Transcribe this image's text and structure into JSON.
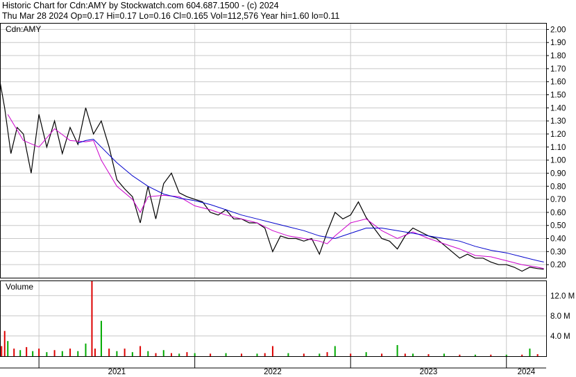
{
  "header": {
    "line1": "Historic Chart for Cdn:AMY by Stockwatch.com 604.687.1500 - (c) 2024",
    "line2": "Thu Mar 28 2024  Op=0.17  Hi=0.17  Lo=0.16  Cl=0.165  Vol=112,576  Year hi=1.60  lo=0.11"
  },
  "chart_data": [
    {
      "type": "line",
      "panel": "price",
      "label": "Cdn:AMY",
      "y_ticks": [
        "2.00",
        "1.90",
        "1.80",
        "1.70",
        "1.60",
        "1.50",
        "1.40",
        "1.30",
        "1.20",
        "1.10",
        "1.00",
        "0.90",
        "0.80",
        "0.70",
        "0.60",
        "0.50",
        "0.40",
        "0.30",
        "0.20"
      ],
      "ylim": [
        0.1,
        2.05
      ],
      "x_labels": [
        "2021",
        "2022",
        "2023",
        "2024"
      ],
      "series": [
        {
          "role": "close",
          "color": "#000000",
          "x": [
            2020.75,
            2020.78,
            2020.82,
            2020.86,
            2020.9,
            2020.95,
            2021.0,
            2021.05,
            2021.1,
            2021.15,
            2021.2,
            2021.25,
            2021.3,
            2021.35,
            2021.4,
            2021.45,
            2021.5,
            2021.55,
            2021.6,
            2021.65,
            2021.7,
            2021.75,
            2021.8,
            2021.85,
            2021.9,
            2021.95,
            2022.0,
            2022.05,
            2022.1,
            2022.15,
            2022.2,
            2022.25,
            2022.3,
            2022.35,
            2022.4,
            2022.45,
            2022.5,
            2022.55,
            2022.6,
            2022.65,
            2022.7,
            2022.75,
            2022.8,
            2022.85,
            2022.9,
            2022.95,
            2023.0,
            2023.05,
            2023.1,
            2023.15,
            2023.2,
            2023.25,
            2023.3,
            2023.35,
            2023.4,
            2023.45,
            2023.5,
            2023.55,
            2023.6,
            2023.65,
            2023.7,
            2023.75,
            2023.8,
            2023.85,
            2023.9,
            2023.95,
            2024.0,
            2024.05,
            2024.1,
            2024.15,
            2024.2,
            2024.24
          ],
          "y": [
            1.6,
            1.4,
            1.05,
            1.25,
            1.2,
            0.9,
            1.35,
            1.1,
            1.3,
            1.05,
            1.25,
            1.12,
            1.4,
            1.2,
            1.3,
            1.1,
            0.85,
            0.78,
            0.72,
            0.52,
            0.8,
            0.55,
            0.82,
            0.9,
            0.75,
            0.72,
            0.7,
            0.68,
            0.6,
            0.58,
            0.62,
            0.55,
            0.55,
            0.52,
            0.52,
            0.48,
            0.3,
            0.42,
            0.4,
            0.4,
            0.38,
            0.4,
            0.28,
            0.45,
            0.6,
            0.55,
            0.58,
            0.68,
            0.56,
            0.48,
            0.4,
            0.38,
            0.32,
            0.42,
            0.48,
            0.45,
            0.42,
            0.4,
            0.35,
            0.3,
            0.25,
            0.28,
            0.25,
            0.25,
            0.22,
            0.2,
            0.2,
            0.18,
            0.15,
            0.18,
            0.17,
            0.165
          ]
        },
        {
          "role": "moving-average-short",
          "color": "#cc00cc",
          "x": [
            2020.8,
            2020.9,
            2021.0,
            2021.1,
            2021.2,
            2021.3,
            2021.35,
            2021.4,
            2021.5,
            2021.6,
            2021.65,
            2021.7,
            2021.8,
            2021.9,
            2022.0,
            2022.1,
            2022.2,
            2022.3,
            2022.4,
            2022.5,
            2022.6,
            2022.7,
            2022.8,
            2022.85,
            2022.9,
            2023.0,
            2023.1,
            2023.2,
            2023.3,
            2023.4,
            2023.5,
            2023.6,
            2023.7,
            2023.8,
            2023.9,
            2024.0,
            2024.1,
            2024.2,
            2024.24
          ],
          "y": [
            1.35,
            1.15,
            1.1,
            1.24,
            1.15,
            1.14,
            1.15,
            1.0,
            0.8,
            0.7,
            0.6,
            0.72,
            0.73,
            0.72,
            0.65,
            0.62,
            0.58,
            0.55,
            0.52,
            0.46,
            0.42,
            0.4,
            0.38,
            0.36,
            0.42,
            0.52,
            0.55,
            0.46,
            0.4,
            0.45,
            0.4,
            0.36,
            0.32,
            0.27,
            0.26,
            0.23,
            0.2,
            0.18,
            0.17
          ]
        },
        {
          "role": "moving-average-long",
          "color": "#0000cc",
          "x": [
            2021.25,
            2021.3,
            2021.35,
            2021.4,
            2021.5,
            2021.6,
            2021.7,
            2021.8,
            2021.9,
            2022.0,
            2022.1,
            2022.2,
            2022.3,
            2022.4,
            2022.5,
            2022.6,
            2022.7,
            2022.8,
            2022.9,
            2023.0,
            2023.1,
            2023.2,
            2023.3,
            2023.4,
            2023.5,
            2023.6,
            2023.7,
            2023.8,
            2023.9,
            2024.0,
            2024.1,
            2024.2,
            2024.24
          ],
          "y": [
            1.13,
            1.15,
            1.16,
            1.1,
            0.98,
            0.88,
            0.8,
            0.74,
            0.71,
            0.69,
            0.66,
            0.62,
            0.58,
            0.55,
            0.52,
            0.49,
            0.46,
            0.42,
            0.4,
            0.44,
            0.48,
            0.48,
            0.46,
            0.44,
            0.42,
            0.4,
            0.38,
            0.34,
            0.31,
            0.29,
            0.26,
            0.23,
            0.22
          ]
        }
      ]
    },
    {
      "type": "bar",
      "panel": "volume",
      "label": "Volume",
      "y_ticks": [
        "12.0 M",
        "8.0 M",
        "4.0 M"
      ],
      "ylim": [
        0,
        15
      ],
      "unit": "M",
      "series": [
        {
          "name": "",
          "x": [
            2020.76,
            2020.78,
            2020.8,
            2020.84,
            2020.88,
            2020.92,
            2020.96,
            2021.0,
            2021.05,
            2021.1,
            2021.15,
            2021.2,
            2021.25,
            2021.3,
            2021.34,
            2021.36,
            2021.4,
            2021.45,
            2021.5,
            2021.55,
            2021.6,
            2021.65,
            2021.7,
            2021.75,
            2021.8,
            2021.85,
            2021.9,
            2021.95,
            2022.0,
            2022.1,
            2022.2,
            2022.3,
            2022.4,
            2022.45,
            2022.5,
            2022.6,
            2022.7,
            2022.8,
            2022.85,
            2022.9,
            2023.0,
            2023.1,
            2023.2,
            2023.3,
            2023.35,
            2023.4,
            2023.5,
            2023.6,
            2023.7,
            2023.8,
            2023.9,
            2024.0,
            2024.1,
            2024.15,
            2024.2
          ],
          "values": [
            2.0,
            5.0,
            3.0,
            1.5,
            1.2,
            1.8,
            1.0,
            1.5,
            0.8,
            1.2,
            1.0,
            1.5,
            1.0,
            2.5,
            15.0,
            1.5,
            7.0,
            1.5,
            1.0,
            1.5,
            0.8,
            2.0,
            1.0,
            0.6,
            1.2,
            0.6,
            0.5,
            0.8,
            0.6,
            0.5,
            0.6,
            0.5,
            0.5,
            0.6,
            2.0,
            0.6,
            0.5,
            0.5,
            0.8,
            2.0,
            0.5,
            0.8,
            0.5,
            2.2,
            0.5,
            0.5,
            0.4,
            0.5,
            0.3,
            0.3,
            0.3,
            0.3,
            0.3,
            1.5,
            0.4
          ],
          "colors": [
            "red",
            "red",
            "green",
            "red",
            "green",
            "red",
            "green",
            "red",
            "green",
            "red",
            "green",
            "red",
            "green",
            "green",
            "red",
            "red",
            "green",
            "red",
            "green",
            "red",
            "green",
            "red",
            "green",
            "red",
            "green",
            "red",
            "green",
            "red",
            "green",
            "red",
            "green",
            "red",
            "green",
            "red",
            "red",
            "green",
            "red",
            "green",
            "red",
            "green",
            "red",
            "green",
            "red",
            "green",
            "red",
            "green",
            "red",
            "green",
            "red",
            "green",
            "red",
            "green",
            "red",
            "green",
            "red"
          ]
        }
      ]
    }
  ],
  "colors": {
    "up": "#00aa00",
    "down": "#dd0000",
    "grid": "#c8c8c8"
  }
}
